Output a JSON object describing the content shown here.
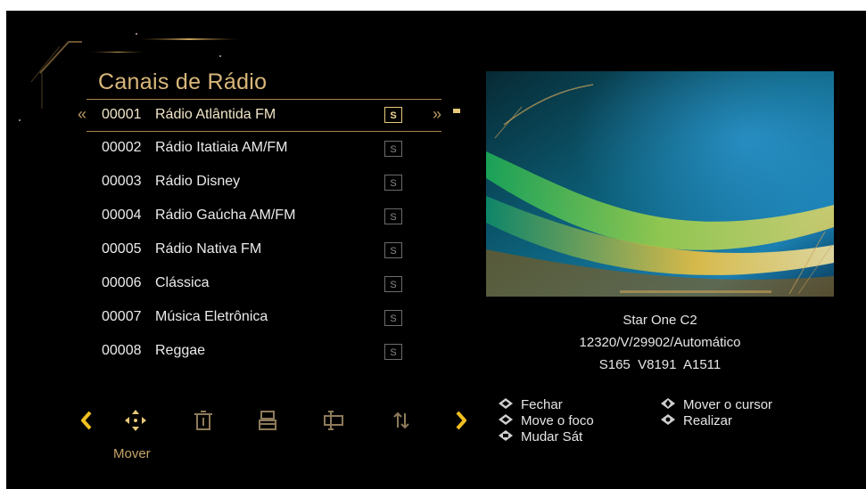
{
  "menu": {
    "title": "Canais de Rádio",
    "channels": [
      {
        "number": "00001",
        "name": "Rádio Atlântida FM",
        "badge": "S"
      },
      {
        "number": "00002",
        "name": "Rádio Itatiaia AM/FM",
        "badge": "S"
      },
      {
        "number": "00003",
        "name": "Rádio Disney",
        "badge": "S"
      },
      {
        "number": "00004",
        "name": "Rádio Gaúcha AM/FM",
        "badge": "S"
      },
      {
        "number": "00005",
        "name": "Rádio Nativa FM",
        "badge": "S"
      },
      {
        "number": "00006",
        "name": "Clássica",
        "badge": "S"
      },
      {
        "number": "00007",
        "name": "Música Eletrônica",
        "badge": "S"
      },
      {
        "number": "00008",
        "name": "Reggae",
        "badge": "S"
      }
    ]
  },
  "satellite": {
    "name": "Star One C2",
    "transponder": "12320/V/29902/Automático",
    "pids": "S165  V8191  A1511"
  },
  "toolbar": {
    "active_label": "Mover",
    "icons": [
      "chevron-left-icon",
      "move-icon",
      "delete-icon",
      "save-icon",
      "rename-icon",
      "sort-icon",
      "chevron-right-icon"
    ]
  },
  "help": {
    "close": "Fechar",
    "move_focus": "Move o foco",
    "change_sat": "Mudar Sát",
    "move_cursor": "Mover o cursor",
    "perform": "Realizar"
  },
  "colors": {
    "accent": "#e8c87a",
    "background": "#000000",
    "text": "#ebebeb"
  }
}
